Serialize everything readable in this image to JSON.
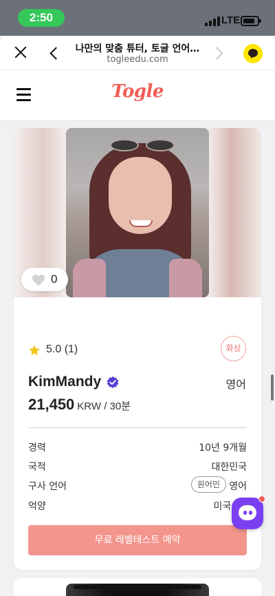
{
  "status_bar": {
    "time": "2:50",
    "network": "LTE"
  },
  "browser": {
    "title": "나만의 맞춤 튜터, 토글 언어…",
    "url": "togleedu.com"
  },
  "header": {
    "logo": "Togle"
  },
  "tutor": {
    "likes": "0",
    "rating": "5.0 (1)",
    "lesson_type_badge": "화상",
    "name": "KimMandy",
    "language": "영어",
    "price": "21,450",
    "price_unit": "KRW / 30분",
    "info": [
      {
        "label": "경력",
        "value": "10년 9개월"
      },
      {
        "label": "국적",
        "value": "대한민국"
      },
      {
        "label": "구사 언어",
        "badge": "원어민",
        "value": "영어"
      },
      {
        "label": "억양",
        "value": "미국 (남"
      }
    ],
    "cta_label": "무료 레벨테스트 예약"
  },
  "colors": {
    "accent": "#f05f57",
    "cta": "#f3958d",
    "verified": "#5b3fd0",
    "star": "#f5c518",
    "chat_fab": "#7b3ff2",
    "status_time_pill": "#34c759"
  },
  "icons": {
    "close": "close-icon",
    "back": "chevron-left-icon",
    "forward": "chevron-right-icon",
    "kakao": "kakao-talk-icon",
    "menu": "hamburger-icon",
    "like": "heart-icon",
    "rating": "star-icon",
    "verified": "verified-badge-icon",
    "chat": "chat-icon"
  }
}
